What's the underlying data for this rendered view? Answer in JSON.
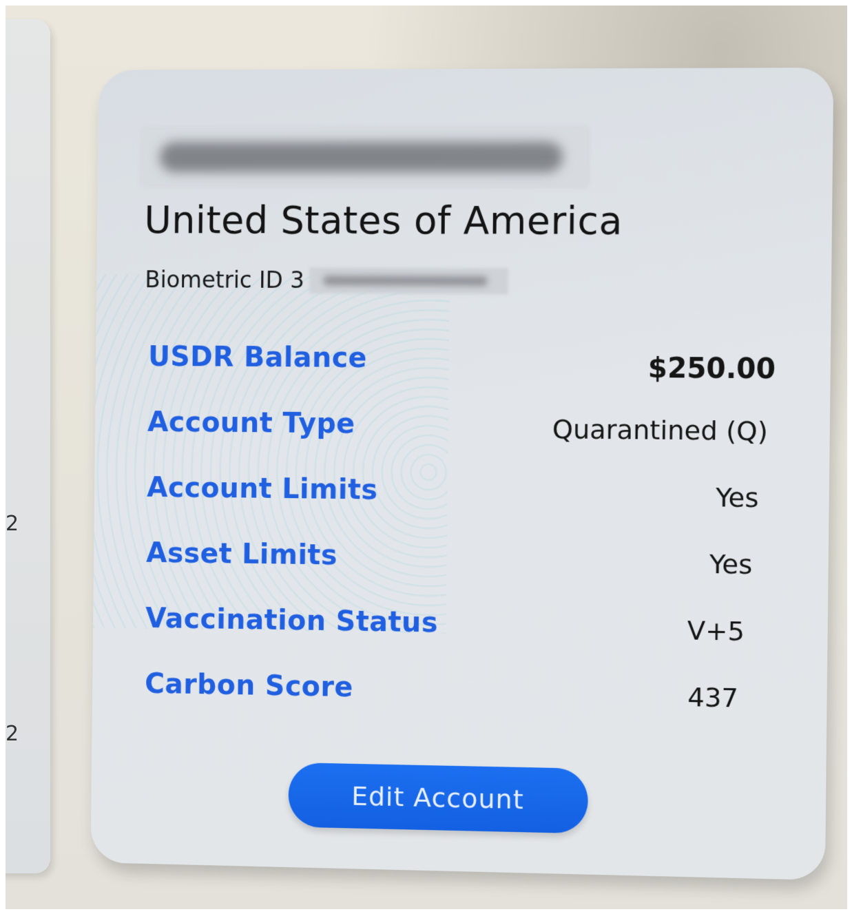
{
  "side_fragments": [
    "2",
    "2"
  ],
  "card": {
    "country": "United States of America",
    "biometric_label": "Biometric ID 3",
    "rows": [
      {
        "label": "USDR Balance",
        "value": "$250.00"
      },
      {
        "label": "Account Type",
        "value": "Quarantined (Q)"
      },
      {
        "label": "Account Limits",
        "value": "Yes"
      },
      {
        "label": "Asset Limits",
        "value": "Yes"
      },
      {
        "label": "Vaccination Status",
        "value": "V+5"
      },
      {
        "label": "Carbon Score",
        "value": "437"
      }
    ],
    "edit_button_label": "Edit Account"
  },
  "colors": {
    "label_blue": "#1f5fe0",
    "button_blue": "#1c6ff0",
    "card_bg": "#e2e6ea"
  }
}
